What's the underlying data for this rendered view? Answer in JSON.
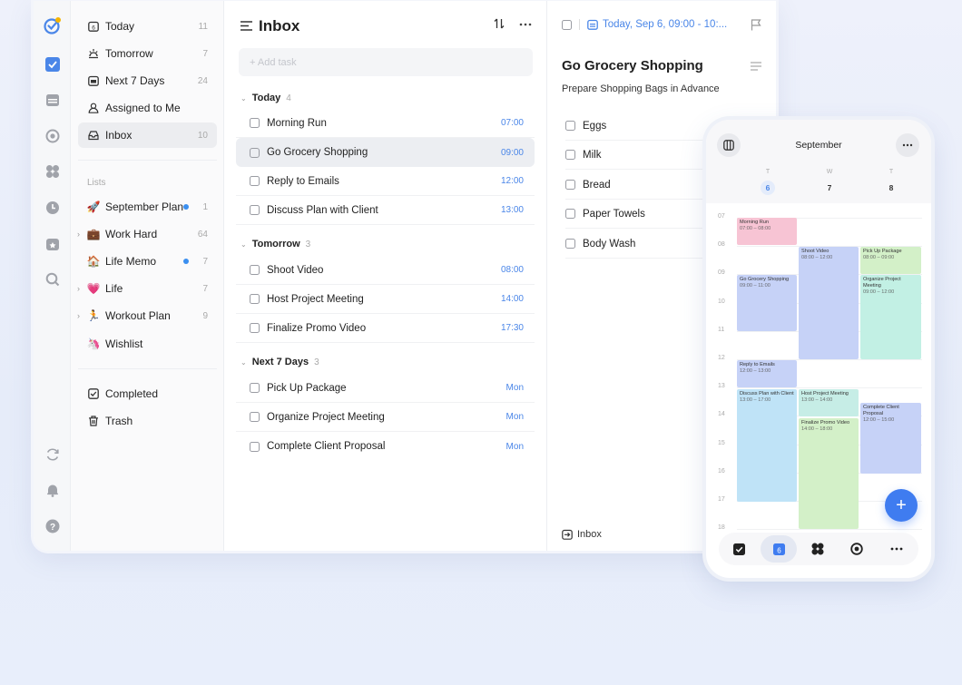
{
  "sidebar": {
    "smart": [
      {
        "label": "Today",
        "count": "11",
        "icon": "calendar-today-icon",
        "glyph": "▣"
      },
      {
        "label": "Tomorrow",
        "count": "7",
        "icon": "sunrise-icon",
        "glyph": "☼"
      },
      {
        "label": "Next 7 Days",
        "count": "24",
        "icon": "calendar-week-icon",
        "glyph": "▤"
      },
      {
        "label": "Assigned to Me",
        "count": "",
        "icon": "person-icon",
        "glyph": "♙"
      },
      {
        "label": "Inbox",
        "count": "10",
        "icon": "inbox-icon",
        "glyph": "⊡"
      }
    ],
    "lists_label": "Lists",
    "lists": [
      {
        "label": "September Plan",
        "count": "1",
        "emoji": "🚀"
      },
      {
        "label": "Work Hard",
        "count": "64",
        "emoji": "💼"
      },
      {
        "label": "Life Memo",
        "count": "7",
        "emoji": "🏠"
      },
      {
        "label": "Life",
        "count": "7",
        "emoji": "💗"
      },
      {
        "label": "Workout Plan",
        "count": "9",
        "emoji": "🏃"
      },
      {
        "label": "Wishlist",
        "count": "",
        "emoji": "🦄"
      }
    ],
    "bottom": [
      {
        "label": "Completed",
        "icon": "completed-icon"
      },
      {
        "label": "Trash",
        "icon": "trash-icon"
      }
    ]
  },
  "main": {
    "title": "Inbox",
    "add_placeholder": "+ Add task",
    "groups": [
      {
        "title": "Today",
        "count": "4",
        "tasks": [
          {
            "label": "Morning Run",
            "time": "07:00"
          },
          {
            "label": "Go Grocery Shopping",
            "time": "09:00"
          },
          {
            "label": "Reply to Emails",
            "time": "12:00"
          },
          {
            "label": "Discuss Plan with Client",
            "time": "13:00"
          }
        ]
      },
      {
        "title": "Tomorrow",
        "count": "3",
        "tasks": [
          {
            "label": "Shoot Video",
            "time": "08:00"
          },
          {
            "label": "Host Project Meeting",
            "time": "14:00"
          },
          {
            "label": "Finalize Promo Video",
            "time": "17:30"
          }
        ]
      },
      {
        "title": "Next 7 Days",
        "count": "3",
        "tasks": [
          {
            "label": "Pick Up Package",
            "time": "Mon"
          },
          {
            "label": "Organize Project Meeting",
            "time": "Mon"
          },
          {
            "label": "Complete Client Proposal",
            "time": "Mon"
          }
        ]
      }
    ]
  },
  "detail": {
    "date": "Today, Sep 6, 09:00 - 10:...",
    "title": "Go Grocery Shopping",
    "description": "Prepare Shopping Bags in Advance",
    "checklist": [
      "Eggs",
      "Milk",
      "Bread",
      "Paper Towels",
      "Body Wash"
    ],
    "list": "Inbox"
  },
  "phone": {
    "month": "September",
    "days": [
      {
        "dow": "T",
        "date": "6"
      },
      {
        "dow": "W",
        "date": "7"
      },
      {
        "dow": "T",
        "date": "8"
      }
    ],
    "hours": [
      "07",
      "08",
      "09",
      "10",
      "11",
      "12",
      "13",
      "14",
      "15",
      "16",
      "17",
      "18"
    ],
    "tab_today": "6",
    "events": [
      {
        "title": "Morning Run",
        "time": "07:00 – 08:00",
        "color": "#f7c4d4"
      },
      {
        "title": "Go Grocery Shopping",
        "time": "09:00 – 11:00",
        "color": "#c6d2f7"
      },
      {
        "title": "Reply to Emails",
        "time": "12:00 – 13:00",
        "color": "#c6d2f7"
      },
      {
        "title": "Discuss Plan with Client",
        "time": "13:00 – 17:00",
        "color": "#bfe3f7"
      },
      {
        "title": "Shoot Video",
        "time": "08:00 – 12:00",
        "color": "#c6d2f7"
      },
      {
        "title": "Host Project Meeting",
        "time": "13:00 – 14:00",
        "color": "#c6ede6"
      },
      {
        "title": "Finalize Promo Video",
        "time": "14:00 – 18:00",
        "color": "#d3f0c8"
      },
      {
        "title": "Pick Up Package",
        "time": "08:00 – 09:00",
        "color": "#d3f0c8"
      },
      {
        "title": "Organize Project Meeting",
        "time": "09:00 – 12:00",
        "color": "#c2f0e4"
      },
      {
        "title": "Complete Client Proposal",
        "time": "12:00 – 15:00",
        "color": "#c6d2f7"
      }
    ]
  },
  "colors": {
    "accent": "#4a86e8",
    "fab": "#3f7cf0"
  }
}
